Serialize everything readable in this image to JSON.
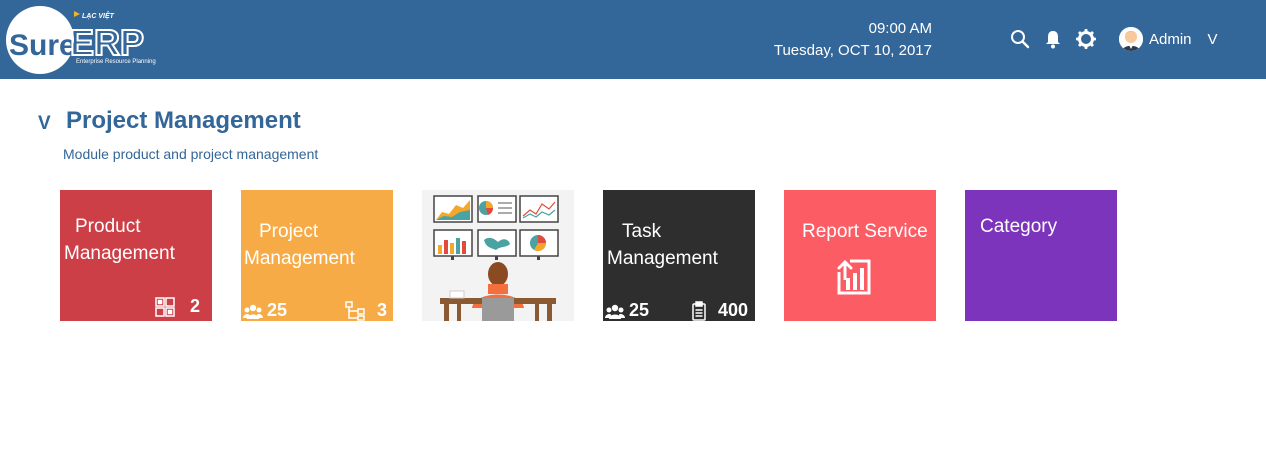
{
  "header": {
    "logo": {
      "brand_small": "LẠC VIỆT",
      "brand_main": "Sure",
      "brand_erp": "ERP",
      "tagline": "Enterprise Resource Planning"
    },
    "time": "09:00 AM",
    "date": "Tuesday, OCT 10, 2017",
    "icons": [
      "search-icon",
      "bell-icon",
      "gear-icon"
    ],
    "user": {
      "name": "Admin",
      "caret": "V"
    }
  },
  "section": {
    "toggle": "V",
    "title": "Project Management",
    "subtitle": "Module product and project management"
  },
  "tiles": [
    {
      "label_line1": "Product",
      "label_line2": "Management",
      "color": "#cc3f46",
      "right_count": "2",
      "right_icon": "grid-icon"
    },
    {
      "label_line1": "Project",
      "label_line2": "Management",
      "color": "#f7ab46",
      "left_count": "25",
      "left_icon": "group-icon",
      "right_count": "3",
      "right_icon": "hierarchy-icon"
    },
    {
      "image": "person-at-desk-dashboard-illustration",
      "color": "#f3f3f3"
    },
    {
      "label_line1": "Task",
      "label_line2": "Management",
      "color": "#2e2e2e",
      "left_count": "25",
      "left_icon": "group-icon",
      "right_count": "400",
      "right_icon": "clipboard-icon"
    },
    {
      "label_line1": "Report Service",
      "color": "#fc5c64",
      "center_icon": "report-chart-icon"
    },
    {
      "label_line1": "Category",
      "color": "#7c34bd"
    }
  ]
}
